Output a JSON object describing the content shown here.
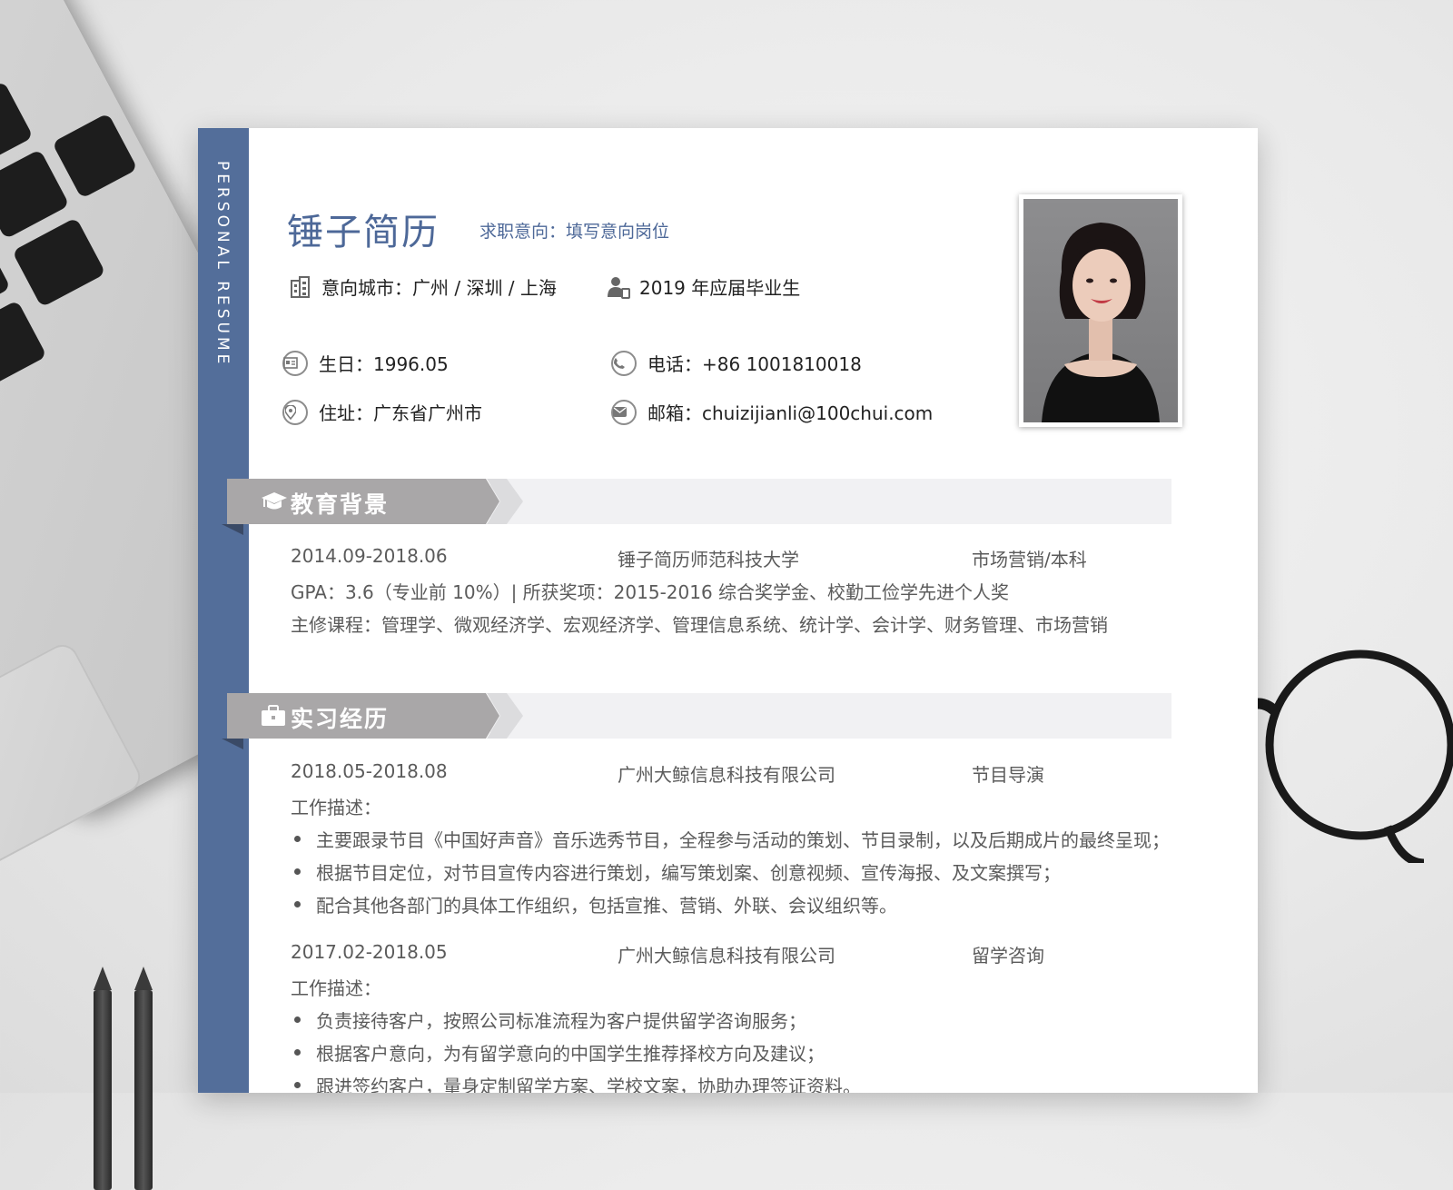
{
  "resume": {
    "side_label": "PERSONAL RESUME",
    "name": "锤子简历",
    "intent": "求职意向：填写意向岗位",
    "city": "意向城市：广州 / 深圳 / 上海",
    "graduate": "2019 年应届毕业生",
    "birthday": "生日：1996.05",
    "phone": "电话：+86 1001810018",
    "address": "住址：广东省广州市",
    "email": "邮箱：chuizijianli@100chui.com"
  },
  "education": {
    "title": "教育背景",
    "period": "2014.09-2018.06",
    "school": "锤子简历师范科技大学",
    "major": "市场营销/本科",
    "gpa": "GPA：3.6（专业前 10%）| 所获奖项：2015-2016 综合奖学金、校勤工俭学先进个人奖",
    "courses": "主修课程：管理学、微观经济学、宏观经济学、管理信息系统、统计学、会计学、财务管理、市场营销"
  },
  "internship": {
    "title": "实习经历",
    "jobs": [
      {
        "period": "2018.05-2018.08",
        "company": "广州大鲸信息科技有限公司",
        "role": "节目导演",
        "desc_label": "工作描述：",
        "bullets": [
          "主要跟录节目《中国好声音》音乐选秀节目，全程参与活动的策划、节目录制，以及后期成片的最终呈现；",
          "根据节目定位，对节目宣传内容进行策划，编写策划案、创意视频、宣传海报、及文案撰写；",
          "配合其他各部门的具体工作组织，包括宣推、营销、外联、会议组织等。"
        ]
      },
      {
        "period": "2017.02-2018.05",
        "company": "广州大鲸信息科技有限公司",
        "role": "留学咨询",
        "desc_label": "工作描述：",
        "bullets": [
          "负责接待客户，按照公司标准流程为客户提供留学咨询服务；",
          "根据客户意向，为有留学意向的中国学生推荐择校方向及建议；",
          "跟进签约客户，量身定制留学方案、学校文案，协助办理签证资料。"
        ]
      }
    ]
  },
  "colors": {
    "accent": "#536e9a",
    "tab": "#a9a7a8",
    "band": "#f1f1f3"
  },
  "icons": [
    "building-icon",
    "graduate-icon",
    "id-card-icon",
    "phone-icon",
    "location-icon",
    "mail-icon",
    "mortarboard-icon",
    "briefcase-icon"
  ]
}
